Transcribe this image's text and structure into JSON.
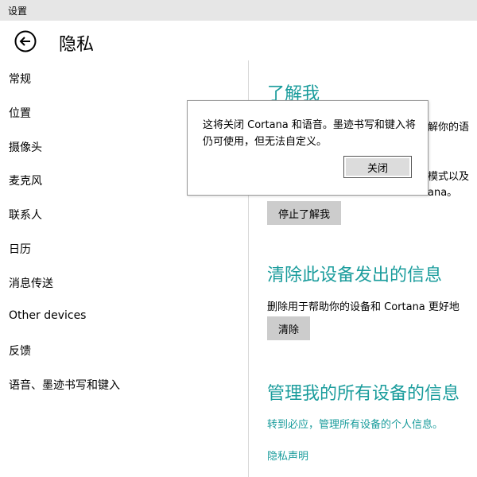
{
  "window": {
    "title": "设置"
  },
  "header": {
    "back_icon": "back-arrow-icon",
    "title": "隐私"
  },
  "sidebar": {
    "items": [
      {
        "label": "常规"
      },
      {
        "label": "位置"
      },
      {
        "label": "摄像头"
      },
      {
        "label": "麦克风"
      },
      {
        "label": "联系人"
      },
      {
        "label": "日历"
      },
      {
        "label": "消息传送"
      },
      {
        "label": "Other devices"
      },
      {
        "label": "反馈"
      },
      {
        "label": "语音、墨迹书写和键入"
      }
    ]
  },
  "main": {
    "section1": {
      "title": "了解我",
      "text_line1": "解你的语",
      "text_line2": "模式以及",
      "text_line3": "ana。",
      "button_label": "停止了解我"
    },
    "section2": {
      "title": "清除此设备发出的信息",
      "text": "删除用于帮助你的设备和 Cortana 更好地",
      "button_label": "清除"
    },
    "section3": {
      "title": "管理我的所有设备的信息",
      "link": "转到必应，管理所有设备的个人信息。"
    },
    "privacy_link": "隐私声明"
  },
  "dialog": {
    "message": "这将关闭 Cortana 和语音。墨迹书写和键入将仍可使用，但无法自定义。",
    "close_label": "关闭"
  },
  "colors": {
    "accent": "#1a9c9c",
    "titlebar": "#e6e6e6",
    "button": "#cccccc"
  }
}
